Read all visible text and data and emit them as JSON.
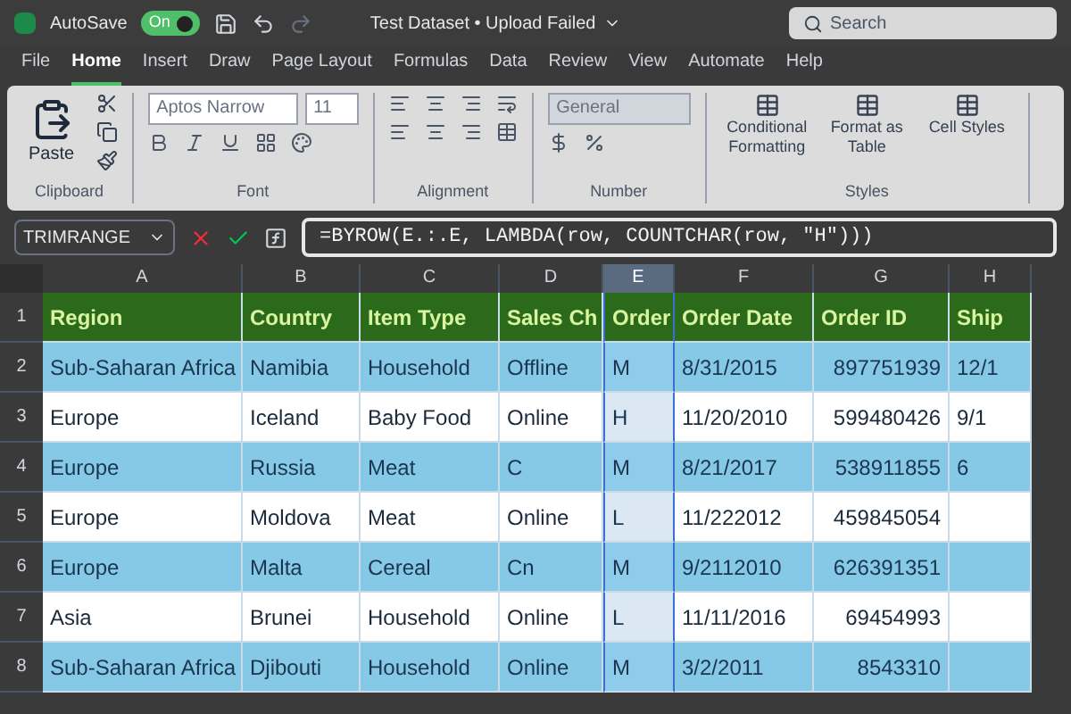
{
  "title_bar": {
    "autosave_label": "AutoSave",
    "autosave": {
      "label": "On",
      "on": true
    },
    "document_title": "Test Dataset • Upload Failed",
    "search_placeholder": "Search"
  },
  "tabs": [
    {
      "label": "File",
      "selected": false
    },
    {
      "label": "Home",
      "selected": true
    },
    {
      "label": "Insert",
      "selected": false
    },
    {
      "label": "Draw",
      "selected": false
    },
    {
      "label": "Page Layout",
      "selected": false
    },
    {
      "label": "Formulas",
      "selected": false
    },
    {
      "label": "Data",
      "selected": false
    },
    {
      "label": "Review",
      "selected": false
    },
    {
      "label": "View",
      "selected": false
    },
    {
      "label": "Automate",
      "selected": false
    },
    {
      "label": "Help",
      "selected": false
    }
  ],
  "ribbon": {
    "groups": [
      {
        "kind": "clipboard",
        "label": "Clipboard",
        "button": "Paste"
      },
      {
        "kind": "font",
        "label": "Font",
        "font_name": "Aptos Narrow",
        "font_size": "11"
      },
      {
        "kind": "alignment",
        "label": "Alignment"
      },
      {
        "kind": "number",
        "label": "Number",
        "format": "General"
      },
      {
        "kind": "styles",
        "label": "Styles",
        "buttons": [
          "Conditional Formatting",
          "Format as Table",
          "Cell Styles"
        ]
      }
    ]
  },
  "formula_bar": {
    "name_box": "TRIMRANGE",
    "formula": "=BYROW(E.:.E, LAMBDA(row, COUNTCHAR(row, \"H\")))"
  },
  "sheet": {
    "columns": [
      {
        "letter": "A",
        "selected": false
      },
      {
        "letter": "B",
        "selected": false
      },
      {
        "letter": "C",
        "selected": false
      },
      {
        "letter": "D",
        "selected": false
      },
      {
        "letter": "E",
        "selected": true
      },
      {
        "letter": "F",
        "selected": false
      },
      {
        "letter": "G",
        "selected": false
      },
      {
        "letter": "H",
        "selected": false
      }
    ],
    "rows": [
      {
        "number": "1",
        "kind": "header",
        "cells": [
          "Region",
          "Country",
          "Item Type",
          "Sales Ch",
          "Order",
          "Order Date",
          "Order ID",
          "Ship"
        ]
      },
      {
        "number": "2",
        "kind": "data",
        "cells": [
          "Sub-Saharan Africa",
          "Namibia",
          "Household",
          "Offline",
          "M",
          "8/31/2015",
          "897751939",
          "12/1"
        ]
      },
      {
        "number": "3",
        "kind": "data",
        "cells": [
          "Europe",
          "Iceland",
          "Baby Food",
          "Online",
          "H",
          "11/20/2010",
          "599480426",
          "9/1"
        ]
      },
      {
        "number": "4",
        "kind": "data",
        "cells": [
          "Europe",
          "Russia",
          "Meat",
          "C",
          "M",
          "8/21/2017",
          "538911855",
          "6"
        ]
      },
      {
        "number": "5",
        "kind": "data",
        "cells": [
          "Europe",
          "Moldova",
          "Meat",
          "Online",
          "L",
          "11/222012",
          "459845054",
          ""
        ]
      },
      {
        "number": "6",
        "kind": "data",
        "cells": [
          "Europe",
          "Malta",
          "Cereal",
          "Cn",
          "M",
          "9/2112010",
          "626391351",
          ""
        ]
      },
      {
        "number": "7",
        "kind": "data",
        "cells": [
          "Asia",
          "Brunei",
          "Household",
          "Online",
          "L",
          "11/11/2016",
          "69454993",
          ""
        ]
      },
      {
        "number": "8",
        "kind": "data",
        "cells": [
          "Sub-Saharan Africa",
          "Djibouti",
          "Household",
          "Online",
          "M",
          "3/2/2011",
          "8543310",
          ""
        ]
      }
    ]
  }
}
